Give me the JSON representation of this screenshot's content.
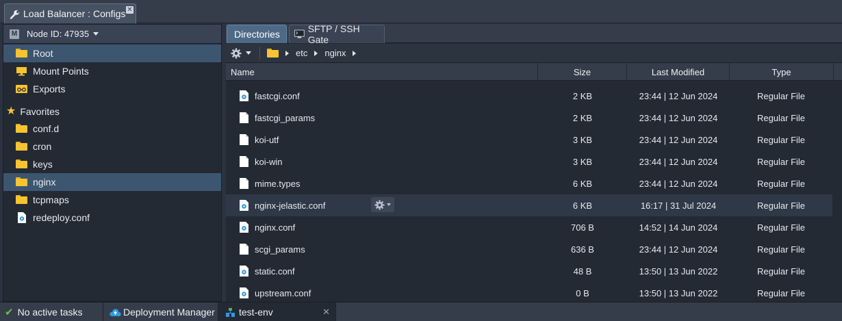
{
  "window": {
    "title": "Load Balancer : Configs",
    "close_symbol": "✕"
  },
  "node": {
    "label": "Node ID: 47935",
    "badge": "M"
  },
  "tree": {
    "root": "Root",
    "mount_points": "Mount Points",
    "exports": "Exports",
    "favorites_header": "Favorites",
    "favorites": [
      "conf.d",
      "cron",
      "keys",
      "nginx",
      "tcpmaps",
      "redeploy.conf"
    ]
  },
  "tabs": {
    "directories": "Directories",
    "sftp": "SFTP / SSH Gate"
  },
  "path": {
    "segments": [
      "etc",
      "nginx"
    ]
  },
  "columns": {
    "name": "Name",
    "size": "Size",
    "modified": "Last Modified",
    "type": "Type"
  },
  "files": [
    {
      "name": "fastcgi.conf",
      "size": "2 KB",
      "modified": "23:44 | 12 Jun 2024",
      "type": "Regular File",
      "icon": "config-file-icon"
    },
    {
      "name": "fastcgi_params",
      "size": "2 KB",
      "modified": "23:44 | 12 Jun 2024",
      "type": "Regular File",
      "icon": "file-icon"
    },
    {
      "name": "koi-utf",
      "size": "3 KB",
      "modified": "23:44 | 12 Jun 2024",
      "type": "Regular File",
      "icon": "file-icon"
    },
    {
      "name": "koi-win",
      "size": "3 KB",
      "modified": "23:44 | 12 Jun 2024",
      "type": "Regular File",
      "icon": "file-icon"
    },
    {
      "name": "mime.types",
      "size": "6 KB",
      "modified": "23:44 | 12 Jun 2024",
      "type": "Regular File",
      "icon": "file-icon"
    },
    {
      "name": "nginx-jelastic.conf",
      "size": "6 KB",
      "modified": "16:17 | 31 Jul 2024",
      "type": "Regular File",
      "icon": "config-file-icon"
    },
    {
      "name": "nginx.conf",
      "size": "706 B",
      "modified": "14:52 | 14 Jun 2024",
      "type": "Regular File",
      "icon": "config-file-icon"
    },
    {
      "name": "scgi_params",
      "size": "636 B",
      "modified": "23:44 | 12 Jun 2024",
      "type": "Regular File",
      "icon": "file-icon"
    },
    {
      "name": "static.conf",
      "size": "48 B",
      "modified": "13:50 | 13 Jun 2022",
      "type": "Regular File",
      "icon": "config-file-icon"
    },
    {
      "name": "upstream.conf",
      "size": "0 B",
      "modified": "13:50 | 13 Jun 2022",
      "type": "Regular File",
      "icon": "config-file-icon"
    }
  ],
  "status": {
    "tasks": "No active tasks",
    "deployment_manager": "Deployment Manager",
    "env": "test-env",
    "close_symbol": "✕"
  },
  "colors": {
    "selected": "#3d5670",
    "folder": "#f6c431",
    "accent": "#4d6986",
    "config_icon": "#2f9be0"
  }
}
